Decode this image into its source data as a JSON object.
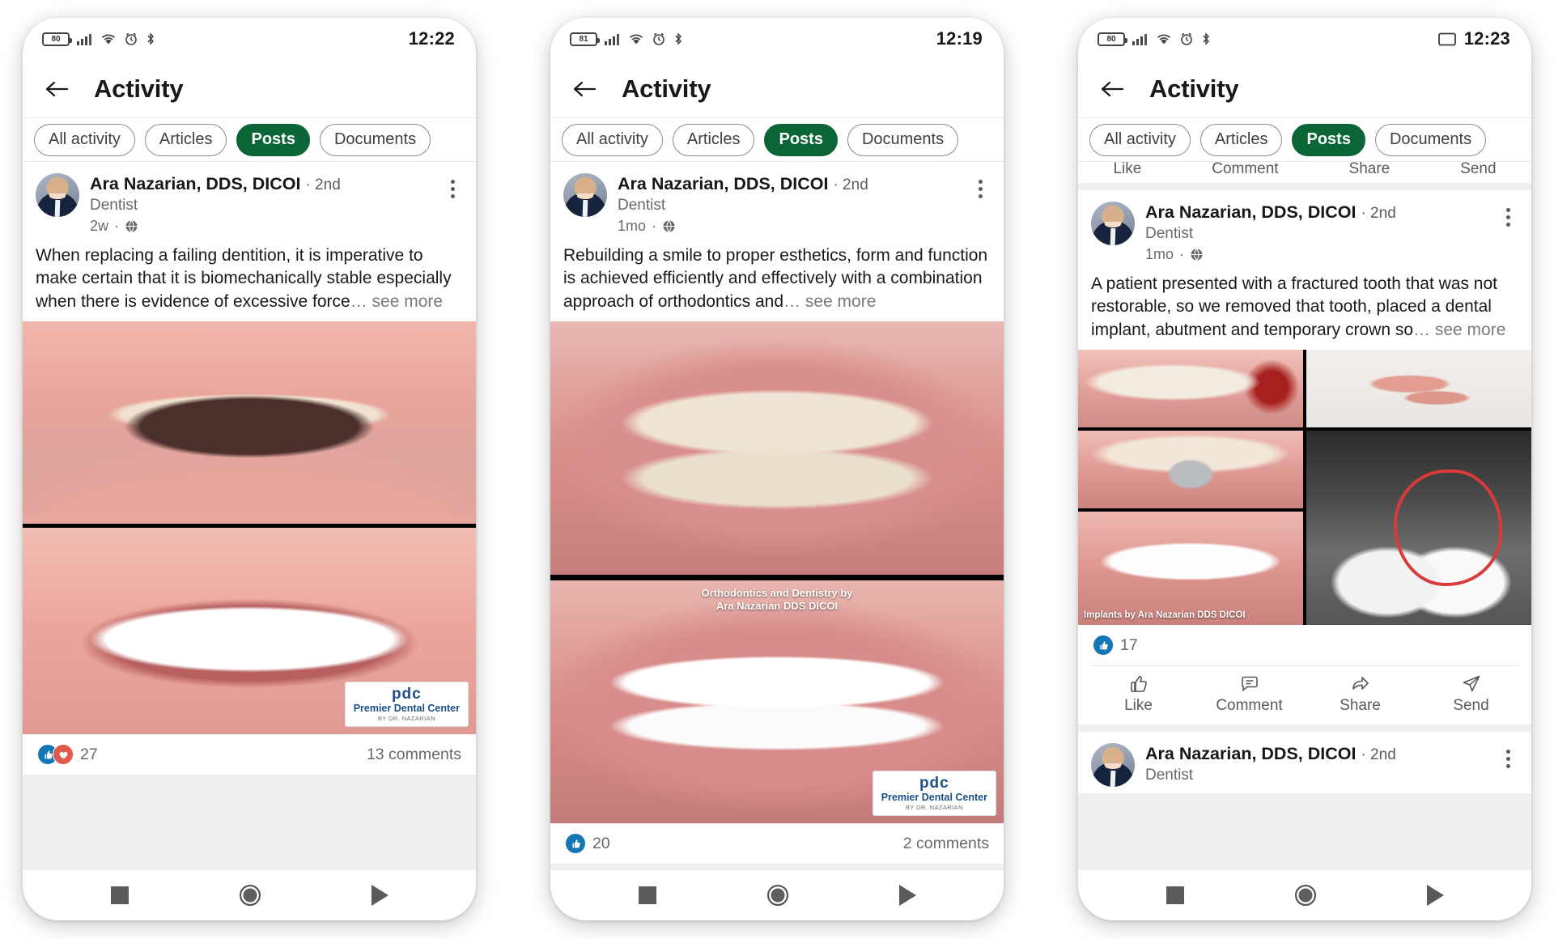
{
  "theme": {
    "accent_green": "#0a6637",
    "like_blue": "#1576b6",
    "love_red": "#df5a4a",
    "text_primary": "#191919",
    "text_secondary": "#6a6a6a"
  },
  "app": {
    "title": "Activity",
    "back_icon": "arrow-left-icon"
  },
  "filters": [
    {
      "label": "All activity",
      "active": false
    },
    {
      "label": "Articles",
      "active": false
    },
    {
      "label": "Posts",
      "active": true
    },
    {
      "label": "Documents",
      "active": false
    }
  ],
  "actions": [
    {
      "label": "Like",
      "icon": "thumbs-up-icon"
    },
    {
      "label": "Comment",
      "icon": "comment-icon"
    },
    {
      "label": "Share",
      "icon": "share-arrow-icon"
    },
    {
      "label": "Send",
      "icon": "send-paper-plane-icon"
    }
  ],
  "nav": {
    "recents": "square-icon",
    "home": "circle-icon",
    "back": "triangle-play-icon"
  },
  "panels": [
    {
      "id": "panel-1",
      "status": {
        "battery": "80",
        "time": "12:22",
        "icons": [
          "battery-icon",
          "signal-icon",
          "wifi-icon",
          "alarm-icon",
          "bluetooth-icon"
        ],
        "cast_icon": false
      },
      "post": {
        "author": "Ara Nazarian, DDS, DICOI",
        "degree": "· 2nd",
        "headline": "Dentist",
        "time": "2w",
        "visibility_icon": "globe-icon",
        "text": "When replacing a failing dentition, it is imperative to make certain that it is biomechanically stable especially when there is evidence of excessive force",
        "see_more": "… see more",
        "images": [
          {
            "name": "pre-op-smile-photo",
            "watermark": null
          },
          {
            "name": "post-op-smile-photo",
            "watermark": "Premier Dental Center"
          }
        ],
        "reaction_count": "27",
        "reaction_types": [
          "like",
          "love"
        ],
        "comments": "13 comments"
      }
    },
    {
      "id": "panel-2",
      "status": {
        "battery": "81",
        "time": "12:19",
        "icons": [
          "battery-icon",
          "signal-icon",
          "wifi-icon",
          "alarm-icon",
          "bluetooth-icon"
        ],
        "cast_icon": false
      },
      "post": {
        "author": "Ara Nazarian, DDS, DICOI",
        "degree": "· 2nd",
        "headline": "Dentist",
        "time": "1mo",
        "visibility_icon": "globe-icon",
        "text": "Rebuilding a smile to proper esthetics, form and function is achieved efficiently and effectively with a combination approach of orthodontics and",
        "see_more": "… see more",
        "images": [
          {
            "name": "orthodontic-pre-op-photo",
            "watermark": null
          },
          {
            "name": "orthodontic-post-op-photo",
            "watermark": "Premier Dental Center",
            "overlay": "Orthodontics and Dentistry by\nAra Nazarian DDS DICOI"
          }
        ],
        "reaction_count": "20",
        "reaction_types": [
          "like"
        ],
        "comments": "2 comments"
      }
    },
    {
      "id": "panel-3",
      "status": {
        "battery": "80",
        "time": "12:23",
        "icons": [
          "battery-icon",
          "signal-icon",
          "wifi-icon",
          "alarm-icon",
          "bluetooth-icon"
        ],
        "cast_icon": true
      },
      "clipped_actions": [
        "Like",
        "Comment",
        "Share",
        "Send"
      ],
      "post": {
        "author": "Ara Nazarian, DDS, DICOI",
        "degree": "· 2nd",
        "headline": "Dentist",
        "time": "1mo",
        "visibility_icon": "globe-icon",
        "text": "A patient presented with a fractured tooth that was not restorable, so we removed that tooth, placed a dental implant, abutment and temporary crown so",
        "see_more": "… see more",
        "images": [
          {
            "name": "fractured-tooth-photo",
            "watermark": null
          },
          {
            "name": "extracted-tooth-tissue-photo",
            "watermark": null
          },
          {
            "name": "implant-placement-photo",
            "watermark": null
          },
          {
            "name": "dental-xray-photo",
            "watermark": null,
            "annotation": "red-circle-marker"
          },
          {
            "name": "final-crown-photo",
            "watermark": "Implants by Ara Nazarian DDS DICOI"
          }
        ],
        "reaction_count": "17",
        "reaction_types": [
          "like"
        ],
        "comments": ""
      },
      "next_post": {
        "author": "Ara Nazarian, DDS, DICOI",
        "degree": "· 2nd",
        "headline": "Dentist"
      }
    }
  ]
}
